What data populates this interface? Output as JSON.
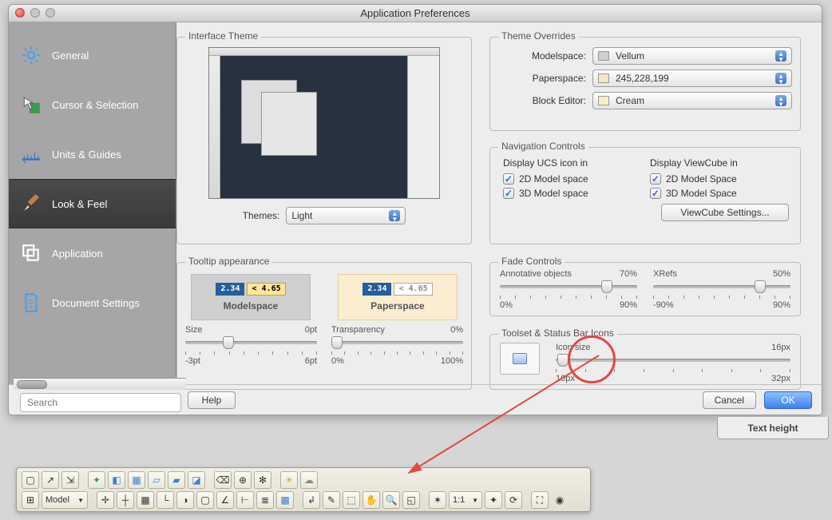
{
  "window": {
    "title": "Application Preferences"
  },
  "sidebar": {
    "items": [
      {
        "label": "General",
        "icon": "gear-icon"
      },
      {
        "label": "Cursor & Selection",
        "icon": "cursor-icon"
      },
      {
        "label": "Units & Guides",
        "icon": "ruler-icon"
      },
      {
        "label": "Look & Feel",
        "icon": "brush-icon"
      },
      {
        "label": "Application",
        "icon": "windows-icon"
      },
      {
        "label": "Document Settings",
        "icon": "document-icon"
      }
    ],
    "selected_index": 3,
    "search_placeholder": "Search"
  },
  "interface_theme": {
    "legend": "Interface Theme",
    "themes_label": "Themes:",
    "theme_value": "Light"
  },
  "tooltip": {
    "legend": "Tooltip appearance",
    "modelspace_label": "Modelspace",
    "paperspace_label": "Paperspace",
    "sample_value_blue": "2.34",
    "sample_value_yellow": "< 4.65",
    "sample_value_grey": "< 4.65",
    "size": {
      "label": "Size",
      "value_label": "0pt",
      "min_label": "-3pt",
      "max_label": "6pt",
      "knob_pct": 33
    },
    "transparency": {
      "label": "Transparency",
      "value_label": "0%",
      "min_label": "0%",
      "max_label": "100%",
      "knob_pct": 0
    }
  },
  "overrides": {
    "legend": "Theme Overrides",
    "modelspace_label": "Modelspace:",
    "modelspace_value": "Vellum",
    "modelspace_swatch": "#cfcfcf",
    "paperspace_label": "Paperspace:",
    "paperspace_value": "245,228,199",
    "paperspace_swatch": "#f5e4c7",
    "blockeditor_label": "Block Editor:",
    "blockeditor_value": "Cream",
    "blockeditor_swatch": "#f9eebe"
  },
  "nav": {
    "legend": "Navigation Controls",
    "ucs_title": "Display UCS icon in",
    "viewcube_title": "Display ViewCube in",
    "ucs_2d": "2D Model space",
    "ucs_3d": "3D Model space",
    "vc_2d": "2D Model Space",
    "vc_3d": "3D Model Space",
    "viewcube_btn": "ViewCube Settings..."
  },
  "fade": {
    "legend": "Fade Controls",
    "annotative": {
      "label": "Annotative objects",
      "value_label": "70%",
      "min_label": "0%",
      "max_label": "90%",
      "knob_pct": 78
    },
    "xrefs": {
      "label": "XRefs",
      "value_label": "50%",
      "min_label": "-90%",
      "max_label": "90%",
      "knob_pct": 78
    }
  },
  "toolset_icons": {
    "legend": "Toolset & Status Bar Icons",
    "icon_size": {
      "label": "Icon size",
      "value_label": "16px",
      "min_label": "16px",
      "max_label": "32px",
      "knob_pct": 0
    }
  },
  "footer": {
    "help": "Help",
    "cancel": "Cancel",
    "ok": "OK"
  },
  "flap": {
    "label": "Text height"
  },
  "bottom_strip": {
    "model_label": "Model",
    "ratio_label": "1:1"
  },
  "colors": {
    "accent_blue": "#3c7ff2",
    "highlight_red": "#e0493f"
  }
}
